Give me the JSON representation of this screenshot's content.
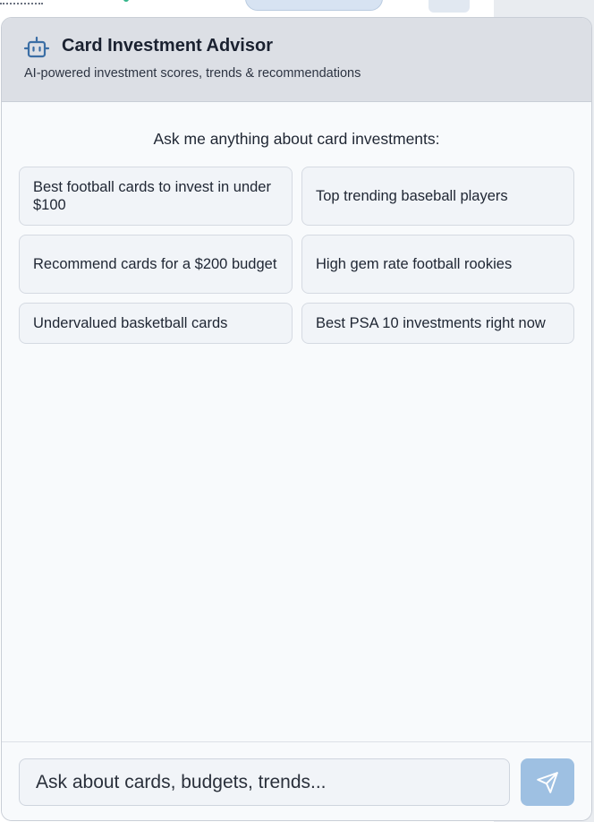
{
  "advisor": {
    "title": "Card Investment Advisor",
    "subtitle": "AI-powered investment scores, trends & recommendations",
    "header_icon": "robot-icon"
  },
  "prompt": {
    "heading": "Ask me anything about card investments:"
  },
  "suggestions": [
    "Best football cards to invest in under $100",
    "Top trending baseball players",
    "Recommend cards for a $200 budget",
    "High gem rate football rookies",
    "Undervalued basketball cards",
    "Best PSA 10 investments right now"
  ],
  "input": {
    "placeholder": "Ask about cards, budgets, trends...",
    "value": ""
  },
  "send": {
    "icon": "send-icon"
  },
  "colors": {
    "header_bg": "#dcdfe5",
    "accent_blue": "#3b6ea5",
    "send_button": "#9ec0e2"
  }
}
